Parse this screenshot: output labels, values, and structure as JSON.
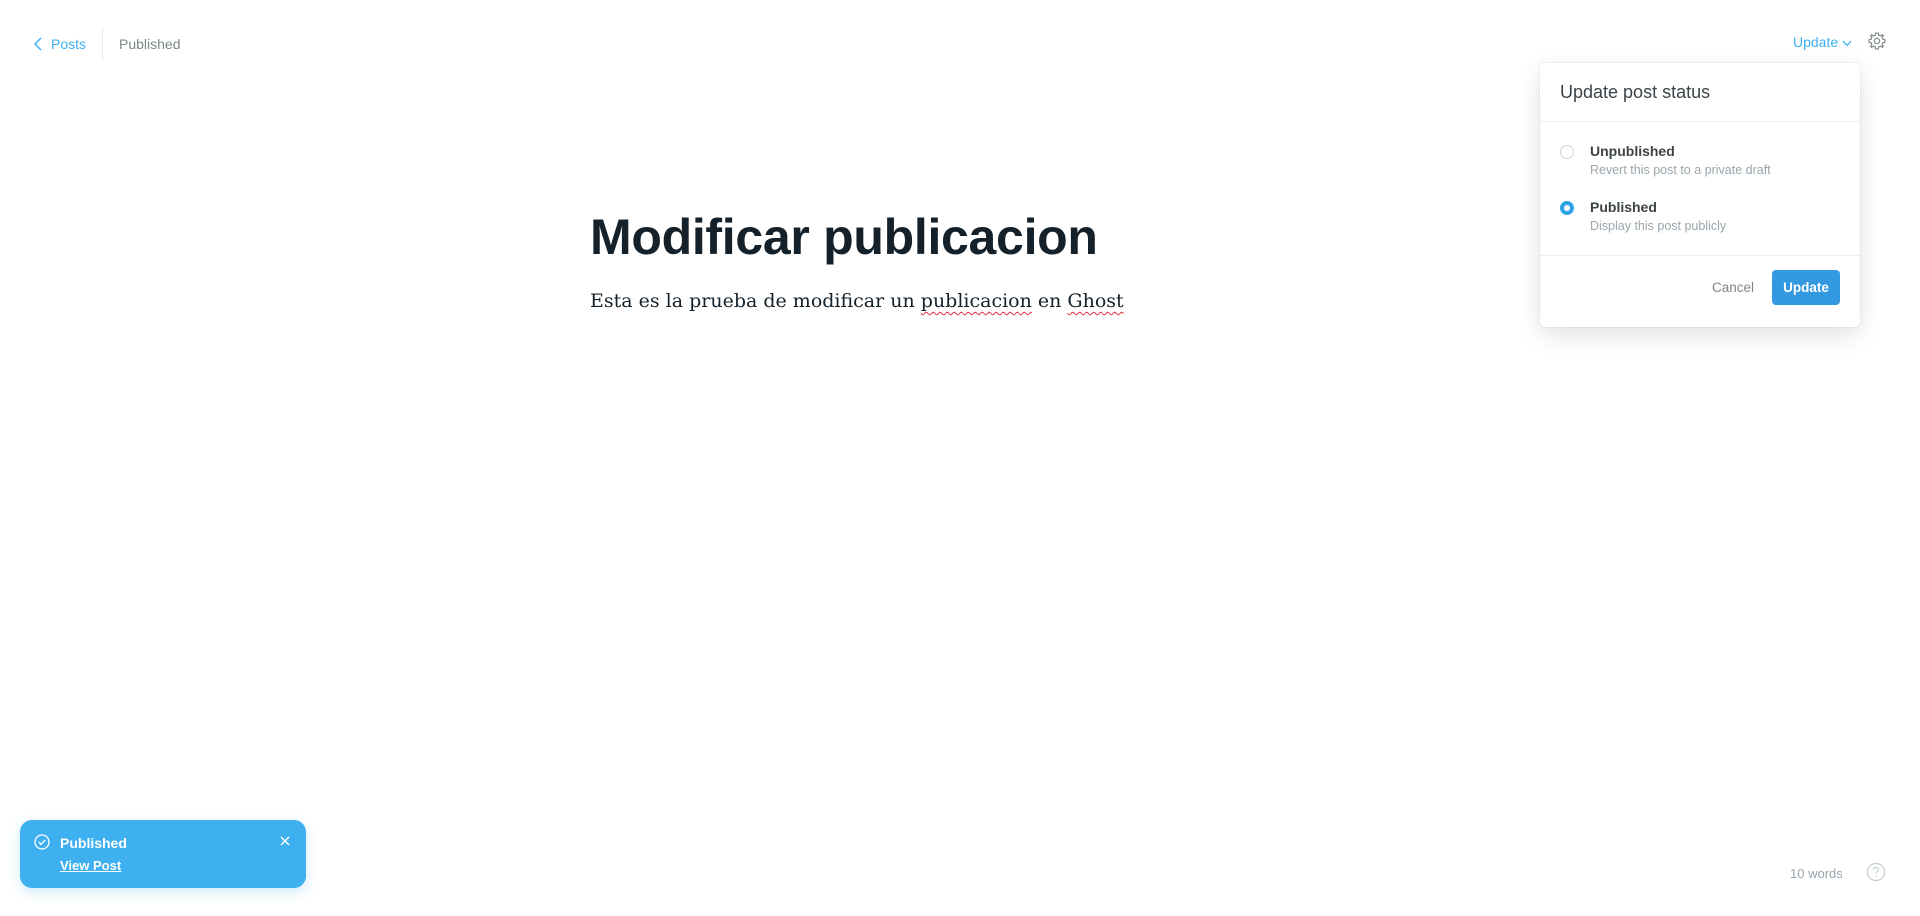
{
  "header": {
    "back_label": "Posts",
    "status": "Published",
    "update_label": "Update"
  },
  "editor": {
    "title": "Modificar publicacion",
    "body_parts": [
      "Esta es la prueba de modificar un ",
      "publicacion",
      " en ",
      "Ghost"
    ]
  },
  "popover": {
    "title": "Update post status",
    "options": [
      {
        "label": "Unpublished",
        "description": "Revert this post to a private draft",
        "selected": false
      },
      {
        "label": "Published",
        "description": "Display this post publicly",
        "selected": true
      }
    ],
    "cancel_label": "Cancel",
    "confirm_label": "Update"
  },
  "toast": {
    "title": "Published",
    "link": "View Post"
  },
  "footer": {
    "word_count": "10 words"
  },
  "colors": {
    "accent": "#3eb0ef",
    "button": "#3399e0",
    "text": "#15212a",
    "muted": "#7d878a"
  },
  "icons": [
    "chevron-left-icon",
    "chevron-down-icon",
    "gear-icon",
    "check-circle-icon",
    "close-icon",
    "help-icon"
  ]
}
